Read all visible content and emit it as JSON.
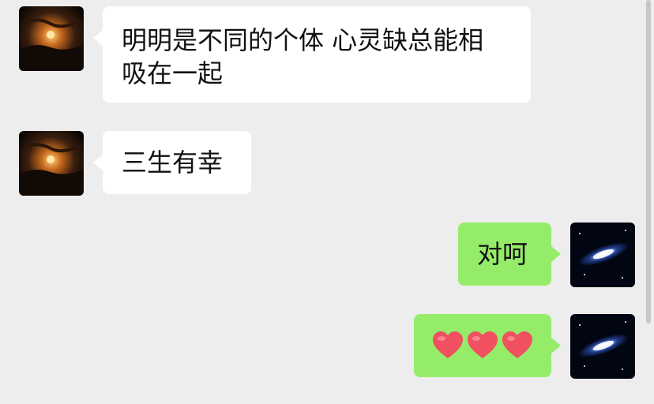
{
  "messages": [
    {
      "side": "incoming",
      "text": "明明是不同的个体 心灵缺总能相吸在一起",
      "line1": "明明是不同的个体 心灵缺总能相",
      "line2": "吸在一起"
    },
    {
      "side": "incoming",
      "text": "三生有幸"
    },
    {
      "side": "outgoing",
      "text": "对呵"
    },
    {
      "side": "outgoing",
      "text": "❤️❤️❤️",
      "emoji": "red-heart",
      "count": 3
    }
  ],
  "colors": {
    "background": "#EDEDED",
    "incoming_bubble": "#FFFFFF",
    "outgoing_bubble": "#95EC69",
    "text": "#111111"
  }
}
